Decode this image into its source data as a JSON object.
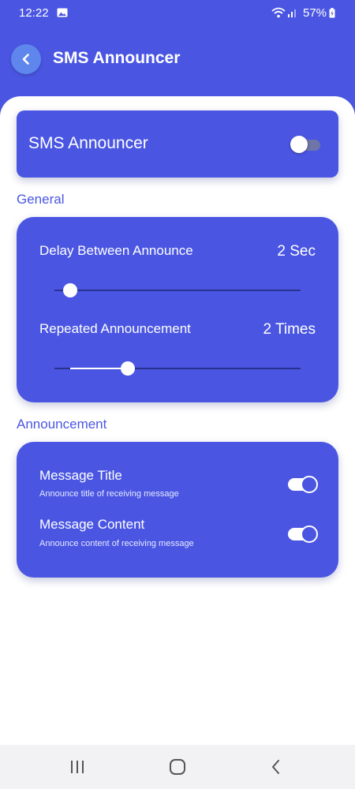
{
  "status_bar": {
    "time": "12:22",
    "battery": "57%"
  },
  "header": {
    "title": "SMS Announcer",
    "back_icon": "chevron-left-icon"
  },
  "master": {
    "label": "SMS Announcer",
    "enabled": false
  },
  "general": {
    "section_title": "General",
    "delay": {
      "label": "Delay Between Announce",
      "value": "2 Sec",
      "slider_fraction": 0
    },
    "repeat": {
      "label": "Repeated Announcement",
      "value": "2 Times",
      "slider_fraction": 0.25
    }
  },
  "announcement": {
    "section_title": "Announcement",
    "items": [
      {
        "title": "Message Title",
        "description": "Announce title of receiving message",
        "enabled": true
      },
      {
        "title": "Message Content",
        "description": "Announce content of receiving message",
        "enabled": true
      }
    ]
  },
  "nav_bar": {
    "icons": [
      "recent-apps-icon",
      "home-icon",
      "back-icon"
    ]
  },
  "colors": {
    "primary": "#4a56e2",
    "accent": "#5e86ec",
    "surface": "#ffffff"
  }
}
